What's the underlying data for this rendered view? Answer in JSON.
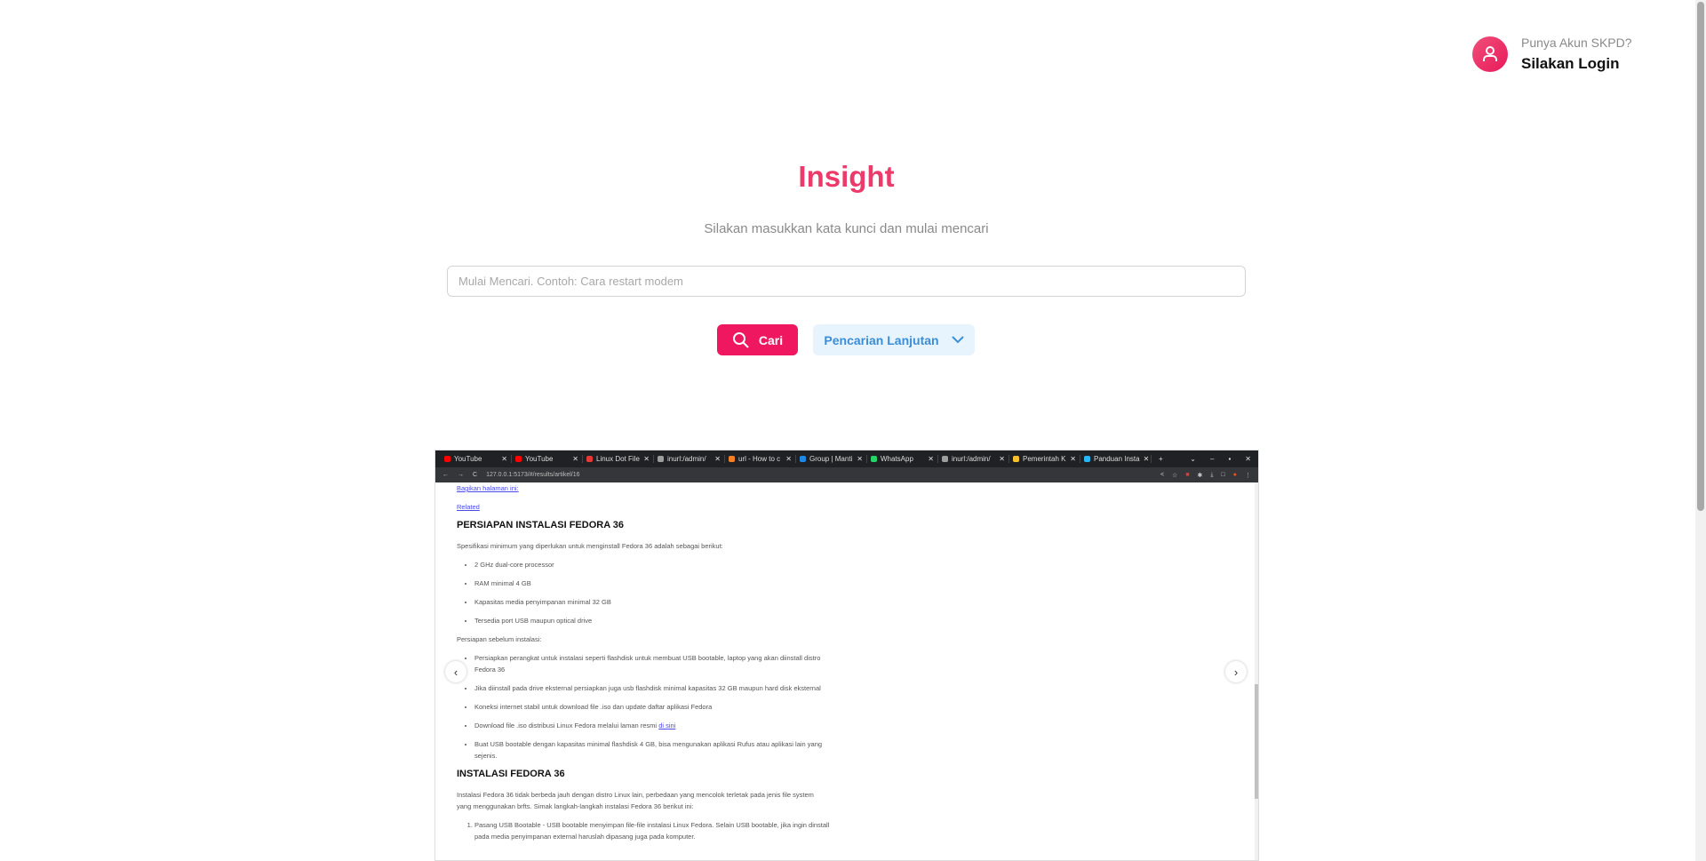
{
  "header": {
    "login_question": "Punya Akun SKPD?",
    "login_label": "Silakan Login",
    "avatar_icon": "user-icon"
  },
  "hero": {
    "title": "Insight",
    "subtitle": "Silakan masukkan kata kunci dan mulai mencari"
  },
  "search": {
    "placeholder": "Mulai Mencari. Contoh: Cara restart modem",
    "value": ""
  },
  "buttons": {
    "search_label": "Cari",
    "advanced_label": "Pencarian Lanjutan"
  },
  "colors": {
    "accent": "#ee1760",
    "title": "#ec3a6a",
    "advanced_bg": "#e8f4fd",
    "advanced_text": "#3b8ed6"
  },
  "carousel": {
    "browser": {
      "tabs": [
        {
          "label": "YouTube",
          "color": "#ff0000"
        },
        {
          "label": "YouTube",
          "color": "#ff0000"
        },
        {
          "label": "Linux Dot File",
          "color": "#e53935"
        },
        {
          "label": "inurl:/admin/",
          "color": "#9e9e9e"
        },
        {
          "label": "url - How to c",
          "color": "#f48024"
        },
        {
          "label": "Group | Manti",
          "color": "#1e88e5"
        },
        {
          "label": "WhatsApp",
          "color": "#25d366"
        },
        {
          "label": "inurl:/admin/",
          "color": "#9e9e9e"
        },
        {
          "label": "Pemerintah K",
          "color": "#fbc02d"
        },
        {
          "label": "Panduan Insta",
          "color": "#29b6f6"
        }
      ],
      "url": "127.0.0.1:5173/#/results/artikel/16"
    },
    "article": {
      "share": "Bagikan halaman ini:",
      "related": "Related",
      "heading1": "PERSIAPAN INSTALASI FEDORA 36",
      "spec_intro": "Spesifikasi minimum yang diperlukan untuk menginstall Fedora 36 adalah sebagai berikut:",
      "specs": [
        "2 GHz dual-core processor",
        "RAM minimal 4 GB",
        "Kapasitas media penyimpanan minimal 32 GB",
        "Tersedia port USB maupun optical drive"
      ],
      "prep_intro": "Persiapan sebelum instalasi:",
      "prep": [
        "Persiapkan perangkat untuk instalasi seperti flashdisk untuk membuat USB bootable, laptop yang akan diinstall distro Fedora 36",
        "Jika diinstall pada drive eksternal persiapkan juga usb flashdisk minimal kapasitas 32 GB maupun hard disk eksternal",
        "Koneksi internet stabil untuk download file .iso dan update daftar aplikasi Fedora",
        "Buat USB bootable dengan kapasitas minimal flashdisk 4 GB, bisa mengunakan aplikasi Rufus atau aplikasi lain yang sejenis."
      ],
      "download_text": "Download file .iso distribusi Linux Fedora melalui laman resmi ",
      "download_link": "di sini",
      "heading2": "INSTALASI FEDORA 36",
      "install_intro": "Instalasi Fedora 36 tidak berbeda jauh dengan distro Linux lain, perbedaan yang mencolok terletak pada jenis file system yang menggunakan brfts. Simak langkah-langkah instalasi Fedora 36 berikut ini:",
      "steps": [
        "Pasang USB Bootable - USB bootable menyimpan file-file instalasi Linux Fedora. Selain USB bootable, jika ingin dinstall pada media penyimpanan external haruslah dipasang juga pada komputer."
      ]
    }
  }
}
